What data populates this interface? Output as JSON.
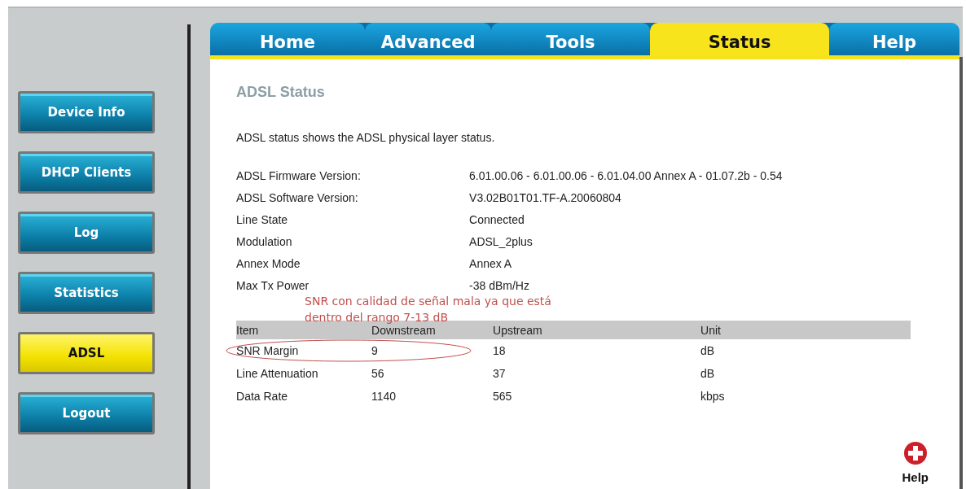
{
  "sidebar": {
    "items": [
      {
        "label": "Device Info",
        "selected": false
      },
      {
        "label": "DHCP Clients",
        "selected": false
      },
      {
        "label": "Log",
        "selected": false
      },
      {
        "label": "Statistics",
        "selected": false
      },
      {
        "label": "ADSL",
        "selected": true
      },
      {
        "label": "Logout",
        "selected": false
      }
    ]
  },
  "tabs": [
    {
      "label": "Home",
      "selected": false
    },
    {
      "label": "Advanced",
      "selected": false
    },
    {
      "label": "Tools",
      "selected": false
    },
    {
      "label": "Status",
      "selected": true
    },
    {
      "label": "Help",
      "selected": false
    }
  ],
  "page": {
    "title": "ADSL Status",
    "description": "ADSL status shows the ADSL physical layer status.",
    "info": [
      {
        "label": "ADSL Firmware Version:",
        "value": "6.01.00.06 - 6.01.00.06 - 6.01.04.00 Annex A - 01.07.2b - 0.54"
      },
      {
        "label": "ADSL Software Version:",
        "value": "V3.02B01T01.TF-A.20060804"
      },
      {
        "label": "Line State",
        "value": "Connected"
      },
      {
        "label": "Modulation",
        "value": "ADSL_2plus"
      },
      {
        "label": "Annex Mode",
        "value": "Annex A"
      },
      {
        "label": "Max Tx Power",
        "value": "-38 dBm/Hz"
      }
    ],
    "annotation": [
      "SNR con calidad de señal mala ya que está",
      "dentro del rango 7-13 dB"
    ],
    "table": {
      "columns": [
        "Item",
        "Downstream",
        "Upstream",
        "Unit"
      ],
      "rows": [
        {
          "cells": [
            "SNR Margin",
            "9",
            "18",
            "dB"
          ],
          "circled": true
        },
        {
          "cells": [
            "Line Attenuation",
            "56",
            "37",
            "dB"
          ],
          "circled": false
        },
        {
          "cells": [
            "Data Rate",
            "1140",
            "565",
            "kbps"
          ],
          "circled": false
        }
      ]
    },
    "help_label": "Help"
  }
}
